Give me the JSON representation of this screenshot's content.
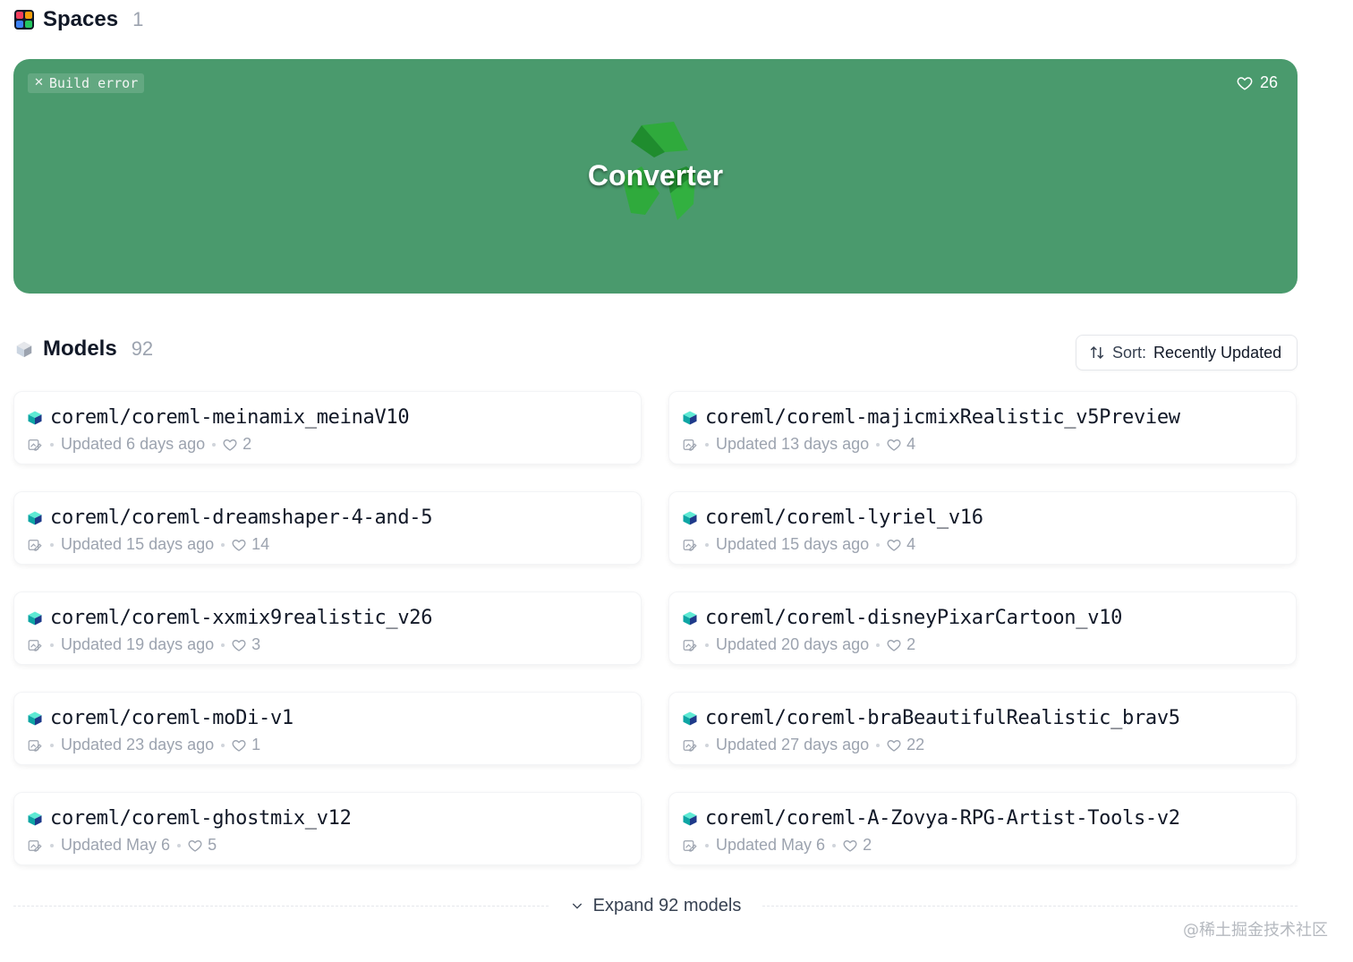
{
  "spaces": {
    "title": "Spaces",
    "count": "1",
    "card": {
      "status": "Build error",
      "likes": "26",
      "title": "Converter",
      "emoji": "recycle-icon",
      "color": "#4a9a6d"
    }
  },
  "models": {
    "title": "Models",
    "count": "92",
    "sort": {
      "label": "Sort:",
      "value": "Recently Updated"
    },
    "items": [
      {
        "name": "coreml/coreml-meinamix_meinaV10",
        "updated": "Updated 6 days ago",
        "likes": "2"
      },
      {
        "name": "coreml/coreml-majicmixRealistic_v5Preview",
        "updated": "Updated 13 days ago",
        "likes": "4"
      },
      {
        "name": "coreml/coreml-dreamshaper-4-and-5",
        "updated": "Updated 15 days ago",
        "likes": "14"
      },
      {
        "name": "coreml/coreml-lyriel_v16",
        "updated": "Updated 15 days ago",
        "likes": "4"
      },
      {
        "name": "coreml/coreml-xxmix9realistic_v26",
        "updated": "Updated 19 days ago",
        "likes": "3"
      },
      {
        "name": "coreml/coreml-disneyPixarCartoon_v10",
        "updated": "Updated 20 days ago",
        "likes": "2"
      },
      {
        "name": "coreml/coreml-moDi-v1",
        "updated": "Updated 23 days ago",
        "likes": "1"
      },
      {
        "name": "coreml/coreml-braBeautifulRealistic_brav5",
        "updated": "Updated 27 days ago",
        "likes": "22"
      },
      {
        "name": "coreml/coreml-ghostmix_v12",
        "updated": "Updated May 6",
        "likes": "5"
      },
      {
        "name": "coreml/coreml-A-Zovya-RPG-Artist-Tools-v2",
        "updated": "Updated May 6",
        "likes": "2"
      }
    ],
    "expand_label": "Expand 92 models"
  },
  "watermark": "@稀土掘金技术社区"
}
